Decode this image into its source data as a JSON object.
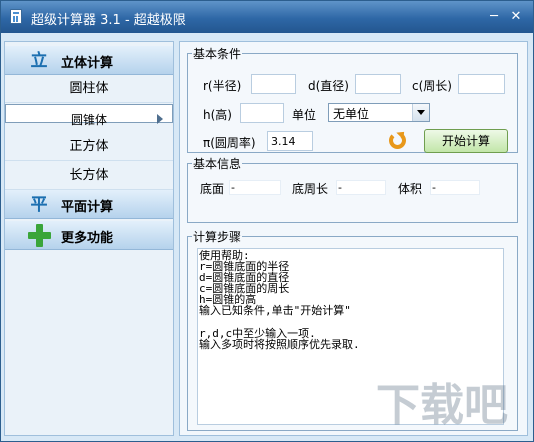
{
  "window": {
    "title": "超级计算器 3.1 - 超越极限",
    "min": "─",
    "close": "✕"
  },
  "sidebar": {
    "category1": {
      "icon": "立",
      "label": "立体计算"
    },
    "items": [
      {
        "label": "圆柱体"
      },
      {
        "label": "圆锥体"
      },
      {
        "label": "正方体"
      },
      {
        "label": "长方体"
      }
    ],
    "category2": {
      "icon": "平",
      "label": "平面计算"
    },
    "category3": {
      "label": "更多功能"
    }
  },
  "basic": {
    "legend": "基本条件",
    "r_label": "r(半径)",
    "r_value": "",
    "d_label": "d(直径)",
    "d_value": "",
    "c_label": "c(周长)",
    "c_value": "",
    "h_label": "h(高)",
    "h_value": "",
    "unit_label": "单位",
    "unit_value": "无单位",
    "pi_label": "π(圆周率)",
    "pi_value": "3.14",
    "calc_button": "开始计算"
  },
  "info": {
    "legend": "基本信息",
    "base_label": "底面",
    "base_value": "-",
    "perim_label": "底周长",
    "perim_value": "-",
    "vol_label": "体积",
    "vol_value": "-"
  },
  "steps": {
    "legend": "计算步骤",
    "text": "使用帮助:\nr=圆锥底面的半径\nd=圆锥底面的直径\nc=圆锥底面的周长\nh=圆锥的高\n输入已知条件,单击\"开始计算\"\n\nr,d,c中至少输入一项.\n输入多项时将按照顺序优先录取."
  },
  "watermark": "下载吧"
}
